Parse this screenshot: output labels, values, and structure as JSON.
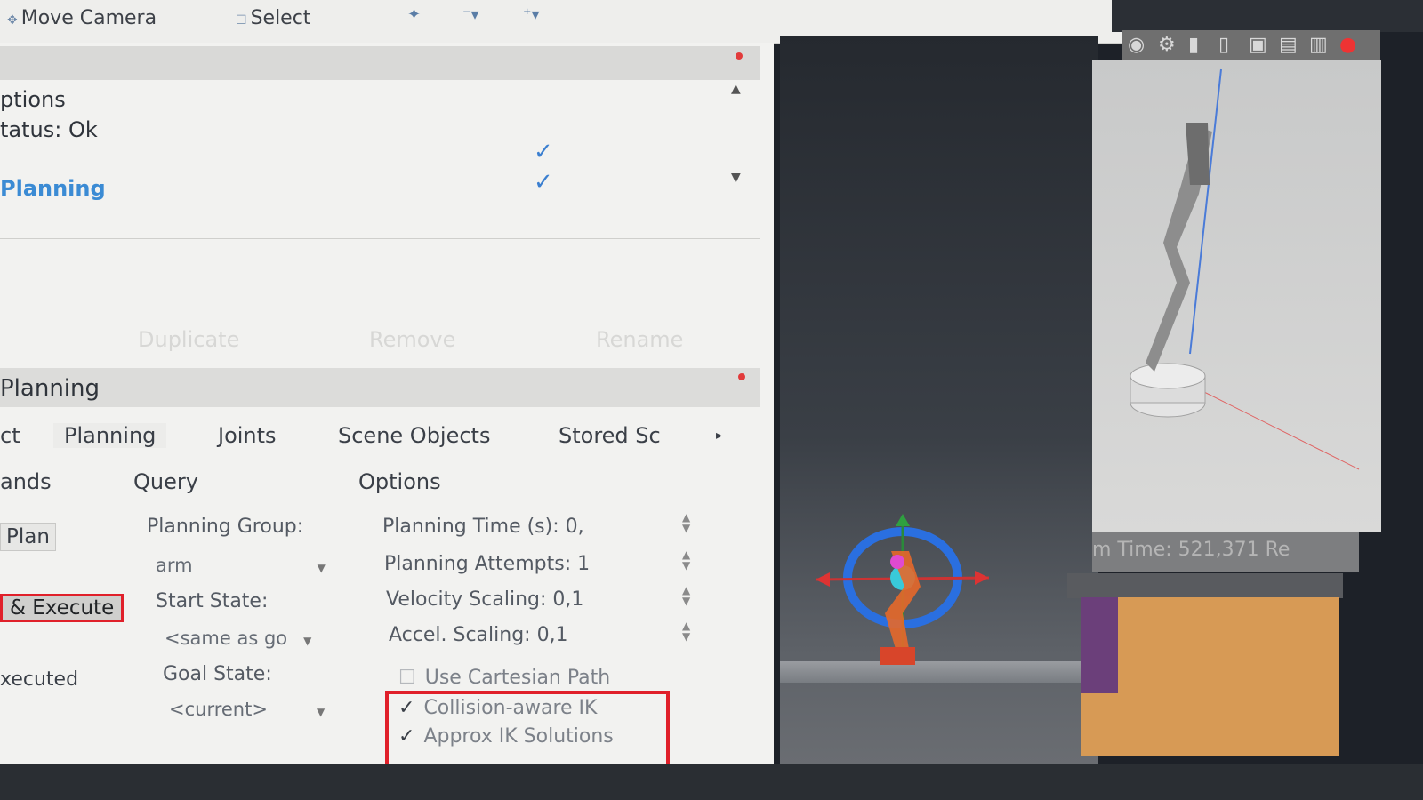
{
  "toolbar": {
    "move_camera": "Move Camera",
    "select": "Select"
  },
  "displays": {
    "rows": [
      {
        "label": "ptions"
      },
      {
        "label": "tatus: Ok"
      },
      {
        "label": "Planning"
      }
    ],
    "checks": [
      "✓",
      "✓"
    ],
    "buttons": [
      "Duplicate",
      "Remove",
      "Rename"
    ]
  },
  "motion_planning": {
    "title": "Planning",
    "tabs": [
      "ct",
      "Planning",
      "Joints",
      "Scene Objects",
      "Stored Sc"
    ],
    "columns": {
      "commands": "ands",
      "query": "Query",
      "options": "Options"
    },
    "commands": {
      "plan": "Plan",
      "plan_execute": "& Execute",
      "executed": "xecuted"
    },
    "query": {
      "planning_group_label": "Planning Group:",
      "planning_group_value": "arm",
      "start_state_label": "Start State:",
      "start_state_value": "<same as go",
      "goal_state_label": "Goal State:",
      "goal_state_value": "<current>"
    },
    "options": {
      "planning_time": "Planning Time (s): 0,",
      "planning_attempts": "Planning Attempts: 1",
      "velocity_scaling": "Velocity Scaling: 0,1",
      "accel_scaling": "Accel. Scaling: 0,1",
      "use_cartesian": "Use Cartesian Path",
      "collision_aware_ik": "Collision-aware IK",
      "approx_ik": "Approx IK Solutions",
      "collision_aware_ik_checked": true,
      "approx_ik_checked": true
    }
  },
  "right_panel": {
    "time_text": "m Time: 521,371 Re"
  },
  "colors": {
    "highlight": "#e0202a",
    "link_blue": "#3b8bd4",
    "orange": "#d79a55"
  }
}
